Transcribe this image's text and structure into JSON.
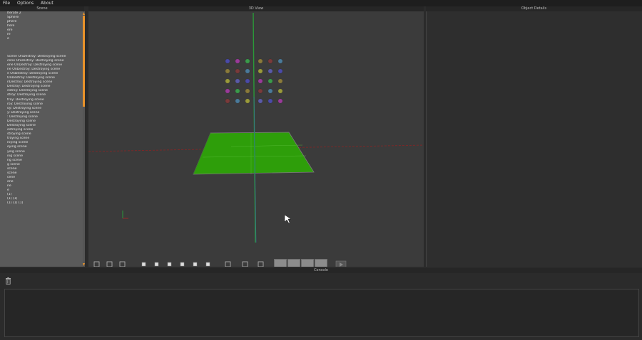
{
  "menu": {
    "file": "File",
    "options": "Options",
    "about": "About"
  },
  "panels": {
    "scene_title": "Scene",
    "view_title": "3D View",
    "details_title": "Object Details",
    "console_title": "Console"
  },
  "scene_items": [
    "Iterate 2",
    "Sphere",
    "phere",
    "here",
    "ere",
    "re",
    "e",
    "",
    "",
    "",
    "Scene OnDestroy: Destroying scene",
    "cene OnDestroy: Destroying scene",
    "ene OnDestroy: Destroying scene",
    "ne OnDestroy: Destroying scene",
    "e OnDestroy: Destroying scene",
    "OnDestroy: Destroying scene",
    "nDestroy: Destroying scene",
    "Destroy: Destroying scene",
    "estroy: Destroying scene",
    "stroy: Destroying scene",
    "troy: Destroying scene",
    "roy: Destroying scene",
    "oy: Destroying scene",
    "y: Destroying scene",
    ": Destroying scene",
    " Destroying scene",
    "Destroying scene",
    "estroying scene",
    "stroying scene",
    "troying scene",
    "roying scene",
    "oying scene",
    "ying scene",
    "ing scene",
    "ng scene",
    "g scene",
    " scene",
    "scene",
    "cene",
    "ene",
    "ne",
    "e",
    "(1)",
    "(1) (1)",
    "(1) (1) (1)"
  ],
  "colors": {
    "scrollbar_accent": "#e8922a",
    "ground_plane": "#2e9e0a",
    "axis_y": "#2a9a38",
    "axis_x": "#9a2a2a"
  },
  "toolbar_icons": [
    "axes-icon",
    "ruler-icon",
    "target-icon",
    "view-front-icon",
    "view-back-icon",
    "view-left-icon",
    "view-right-icon",
    "view-top-icon",
    "view-bottom-icon",
    "fullscreen-icon",
    "camera-icon",
    "grid-toggle-icon"
  ],
  "console": {
    "trash_icon": "trash-icon"
  }
}
